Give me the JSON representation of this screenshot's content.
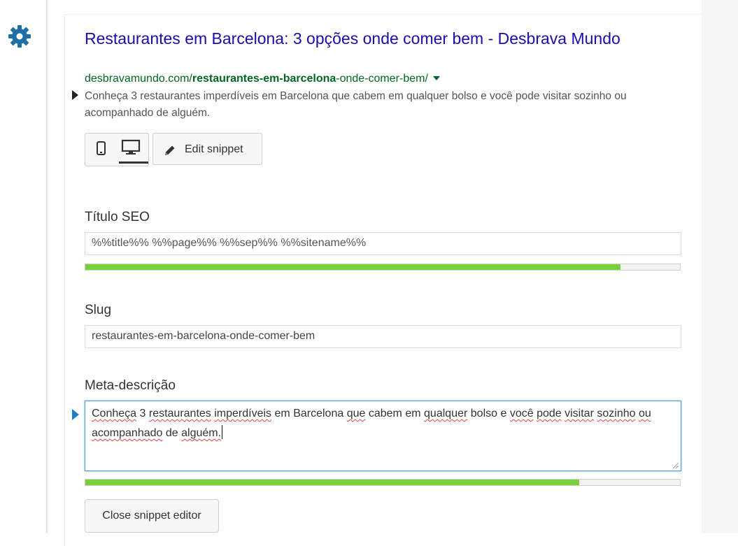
{
  "sidebar": {
    "settings_icon": "gear-icon"
  },
  "snippet_preview": {
    "title": "Restaurantes em Barcelona: 3 opções onde comer bem - Desbrava Mundo",
    "url_prefix": "desbravamundo.com/",
    "url_slug_bold": "restaurantes-em-barcelona",
    "url_suffix": "-onde-comer-bem/",
    "description": "Conheça 3 restaurantes imperdíveis em Barcelona que cabem em qualquer bolso e você pode visitar sozinho ou acompanhado de alguém."
  },
  "toolbar": {
    "mobile_icon": "mobile-icon",
    "desktop_icon": "desktop-icon",
    "active_view": "desktop",
    "edit_label": "Edit snippet"
  },
  "seo_title": {
    "label": "Título SEO",
    "value": "%%title%% %%page%% %%sep%% %%sitename%%",
    "progress_percent": 90
  },
  "slug": {
    "label": "Slug",
    "value": "restaurantes-em-barcelona-onde-comer-bem"
  },
  "meta_description": {
    "label": "Meta-descrição",
    "words": [
      "Conheça",
      "3",
      "restaurantes",
      "imperdíveis",
      "em",
      "Barcelona",
      "que",
      "cabem",
      "em",
      "qualquer",
      "bolso",
      "e",
      "você",
      "pode",
      "visitar",
      "sozinho",
      "ou",
      "acompanhado",
      "de",
      "alguém."
    ],
    "progress_percent": 83
  },
  "close_label": "Close snippet editor",
  "colors": {
    "link": "#1a0dab",
    "url": "#006621",
    "progress_good": "#7ad03a",
    "focus_border": "#5b9dd9"
  }
}
